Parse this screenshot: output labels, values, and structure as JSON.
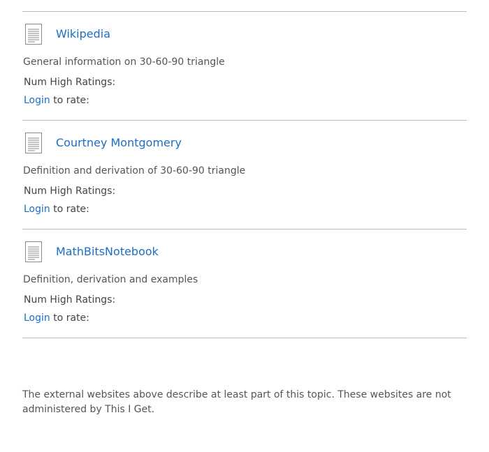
{
  "entries": [
    {
      "title": "Wikipedia",
      "description": "General information on 30-60-90 triangle",
      "ratings_label": "Num High Ratings:",
      "login_label": "Login",
      "rate_suffix": " to rate:",
      "icon": "document-icon"
    },
    {
      "title": "Courtney Montgomery",
      "description": "Definition and derivation of 30-60-90 triangle",
      "ratings_label": "Num High Ratings:",
      "login_label": "Login",
      "rate_suffix": " to rate:",
      "icon": "document-icon"
    },
    {
      "title": "MathBitsNotebook",
      "description": "Definition, derivation and examples",
      "ratings_label": "Num High Ratings:",
      "login_label": "Login",
      "rate_suffix": " to rate:",
      "icon": "document-icon"
    }
  ],
  "footer": {
    "note": "The external websites above describe at least part of this topic. These websites are not administered by This I Get."
  },
  "colors": {
    "link": "#1a6fc4",
    "text": "#555555",
    "divider": "#bdbdbd"
  }
}
